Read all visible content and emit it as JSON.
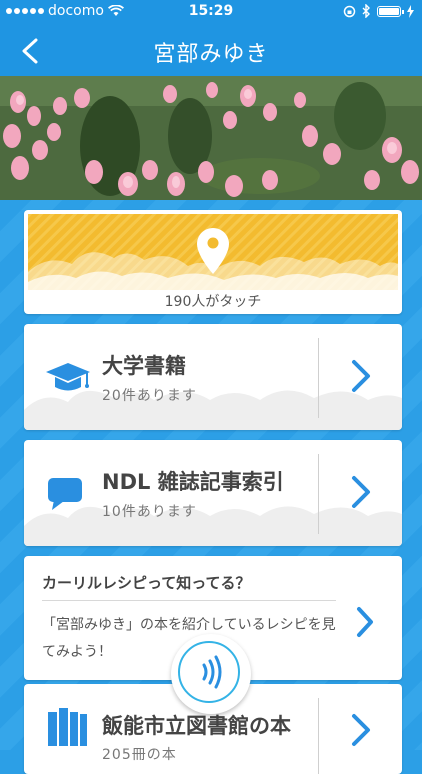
{
  "status_bar": {
    "carrier": "docomo",
    "time": "15:29"
  },
  "nav": {
    "title": "宮部みゆき"
  },
  "touch": {
    "count_text": "190人がタッチ"
  },
  "cards": [
    {
      "title": "大学書籍",
      "subtitle": "20件あります",
      "icon": "graduation-cap-icon"
    },
    {
      "title": "NDL 雑誌記事索引",
      "subtitle": "10件あります",
      "icon": "speech-bubble-icon"
    }
  ],
  "kaririru": {
    "title": "カーリルレシピって知ってる？",
    "body": "「宮部みゆき」の本を紹介しているレシピを見てみよう！"
  },
  "library": {
    "title": "飯能市立図書館の本",
    "subtitle": "205冊の本",
    "icon": "books-icon"
  },
  "colors": {
    "primary": "#1f95e2",
    "accent": "#2a8fe0",
    "band": "#f3bb2f"
  }
}
